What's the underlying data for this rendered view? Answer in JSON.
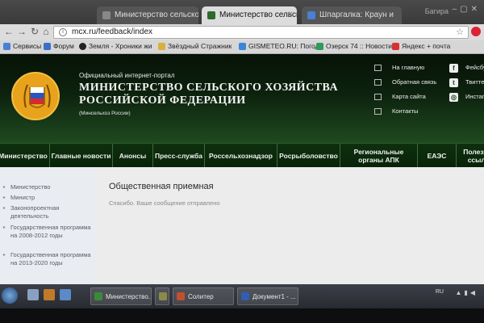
{
  "browser": {
    "tabs": [
      {
        "label": "Министерство сельско"
      },
      {
        "label": "Министерство сельско"
      },
      {
        "label": "Шпаргалка: Краун и"
      }
    ],
    "user_name": "Багира",
    "url": "mcx.ru/feedback/index",
    "bookmarks": [
      {
        "label": "Сервисы",
        "color": "#4a7fd6"
      },
      {
        "label": "Форум",
        "color": "#3a6fc8"
      },
      {
        "label": "Земля - Хроники жи",
        "color": "#222222"
      },
      {
        "label": "Звёздный Стражник",
        "color": "#d8b03a"
      },
      {
        "label": "GISMETEO.RU: Погод",
        "color": "#3a86d8"
      },
      {
        "label": "Озерск 74 :: Новости",
        "color": "#2f9a5a"
      },
      {
        "label": "Яндекс + почта",
        "color": "#d83030"
      }
    ]
  },
  "site": {
    "portal_label": "Официальный интернет-портал",
    "title": "МИНИСТЕРСТВО СЕЛЬСКОГО ХОЗЯЙСТВА РОССИЙСКОЙ ФЕДЕРАЦИИ",
    "short_name": "(Минсельхоз России)",
    "header_links": [
      {
        "label": "На главную",
        "icon": "home-icon"
      },
      {
        "label": "Обратная связь",
        "icon": "mail-icon"
      },
      {
        "label": "Карта сайта",
        "icon": "sitemap-icon"
      },
      {
        "label": "Контакты",
        "icon": "contacts-icon"
      }
    ],
    "social": [
      {
        "label": "Фейсбук",
        "icon": "facebook-icon",
        "glyph": "f"
      },
      {
        "label": "Твиттер",
        "icon": "twitter-icon",
        "glyph": "t"
      },
      {
        "label": "Инстаграм",
        "icon": "instagram-icon",
        "glyph": "◎"
      }
    ],
    "nav": [
      "Министерство",
      "Главные новости",
      "Анонсы",
      "Пресс-служба",
      "Россельхознадзор",
      "Росрыболовство",
      "Региональные органы АПК",
      "ЕАЭС",
      "Полезные ссылки"
    ],
    "sidebar": [
      "Министерство",
      "Министр",
      "Законопроектная деятельность",
      "Государственная программа на 2008-2012 годы",
      "Государственная программа на 2013-2020 годы"
    ],
    "page_title": "Общественная приемная",
    "message": "Спасибо. Ваше сообщение отправлено"
  },
  "taskbar": {
    "items": [
      {
        "label": "Министерство...",
        "color": "#3a8a3a"
      },
      {
        "label": "",
        "color": "#8a8a4a"
      },
      {
        "label": "Солитер",
        "color": "#c05030"
      },
      {
        "label": "Документ1 - ...",
        "color": "#2f5fb0"
      }
    ],
    "language": "RU"
  }
}
